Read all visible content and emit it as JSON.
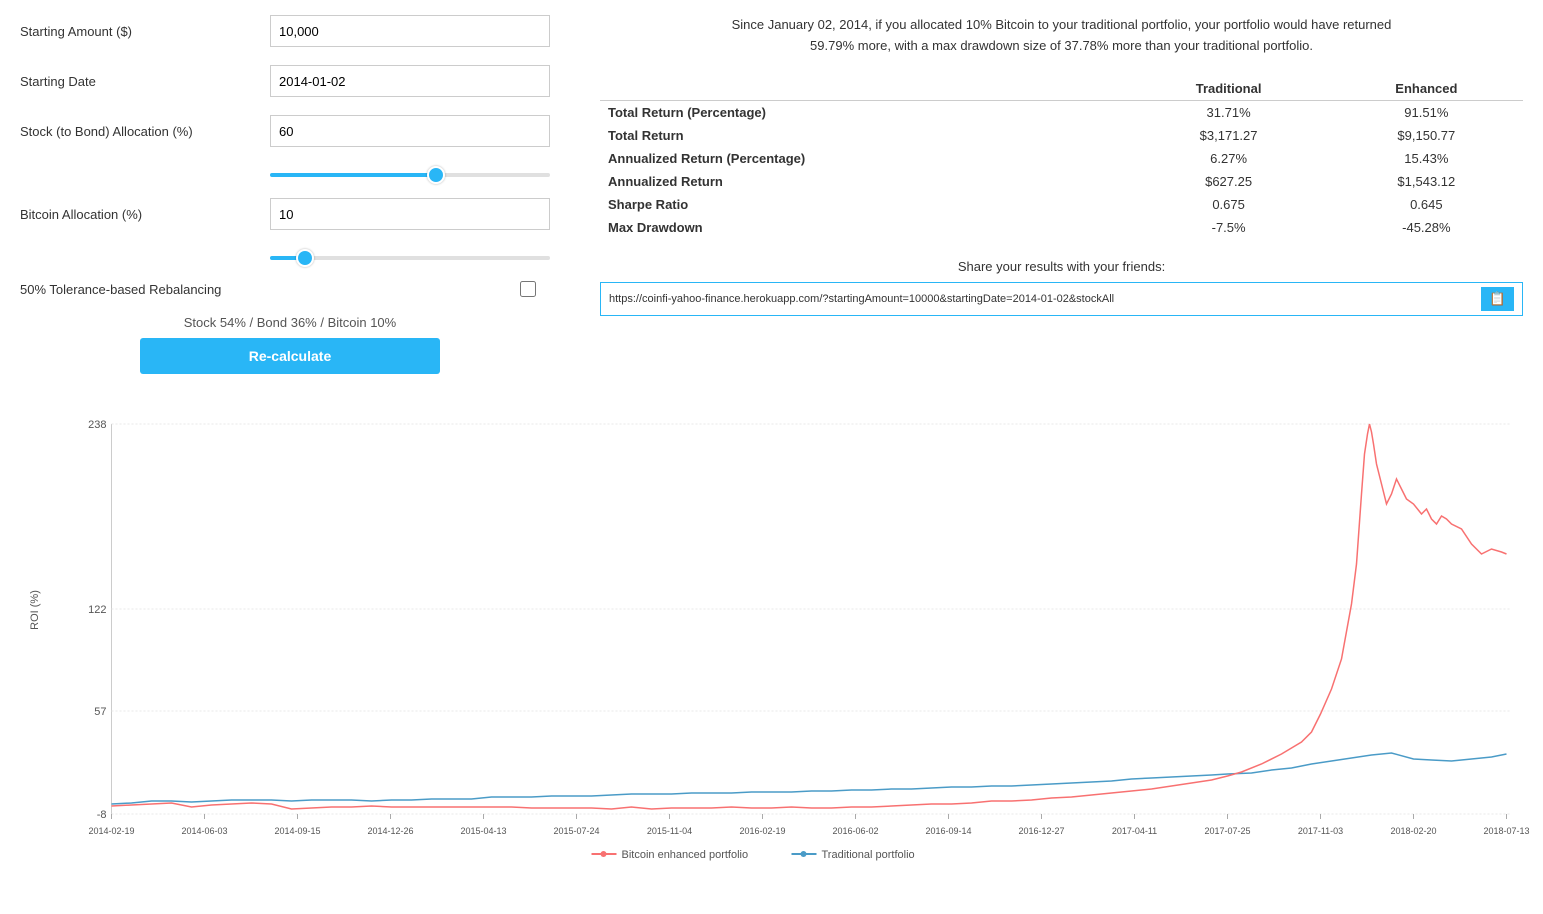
{
  "form": {
    "starting_amount_label": "Starting Amount ($)",
    "starting_amount_value": "10,000",
    "starting_date_label": "Starting Date",
    "starting_date_value": "2014-01-02",
    "stock_bond_label": "Stock (to Bond) Allocation (%)",
    "stock_bond_value": "60",
    "stock_bond_slider_value": 60,
    "bitcoin_label": "Bitcoin Allocation (%)",
    "bitcoin_value": "10",
    "bitcoin_slider_value": 10,
    "rebalancing_label": "50% Tolerance-based Rebalancing",
    "allocation_text": "Stock 54% / Bond 36% / Bitcoin 10%",
    "recalculate_label": "Re-calculate"
  },
  "summary": {
    "text": "Since January 02, 2014, if you allocated 10% Bitcoin to your traditional portfolio, your portfolio would have returned 59.79% more, with a max drawdown size of 37.78% more than your traditional portfolio."
  },
  "results": {
    "col1": "",
    "col2": "Traditional",
    "col3": "Enhanced",
    "rows": [
      {
        "label": "Total Return (Percentage)",
        "traditional": "31.71%",
        "enhanced": "91.51%"
      },
      {
        "label": "Total Return",
        "traditional": "$3,171.27",
        "enhanced": "$9,150.77"
      },
      {
        "label": "Annualized Return (Percentage)",
        "traditional": "6.27%",
        "enhanced": "15.43%"
      },
      {
        "label": "Annualized Return",
        "traditional": "$627.25",
        "enhanced": "$1,543.12"
      },
      {
        "label": "Sharpe Ratio",
        "traditional": "0.675",
        "enhanced": "0.645"
      },
      {
        "label": "Max Drawdown",
        "traditional": "-7.5%",
        "enhanced": "-45.28%"
      }
    ]
  },
  "share": {
    "label": "Share your results with your friends:",
    "url": "https://coinfi-yahoo-finance.herokuapp.com/?startingAmount=10000&startingDate=2014-01-02&stockAll",
    "copy_icon": "📋"
  },
  "chart": {
    "y_label": "ROI (%)",
    "y_ticks": [
      "238",
      "122",
      "57",
      "-8"
    ],
    "x_ticks": [
      "2014-02-19",
      "2014-06-03",
      "2014-09-15",
      "2014-12-26",
      "2015-04-13",
      "2015-07-24",
      "2015-11-04",
      "2016-02-19",
      "2016-06-02",
      "2016-09-14",
      "2016-12-27",
      "2017-04-11",
      "2017-07-25",
      "2017-11-03",
      "2018-02-20",
      "2018-07-13"
    ],
    "legend": [
      {
        "label": "Bitcoin enhanced portfolio",
        "color": "#f87171",
        "type": "line"
      },
      {
        "label": "Traditional portfolio",
        "color": "#4a9bc7",
        "type": "line"
      }
    ]
  }
}
